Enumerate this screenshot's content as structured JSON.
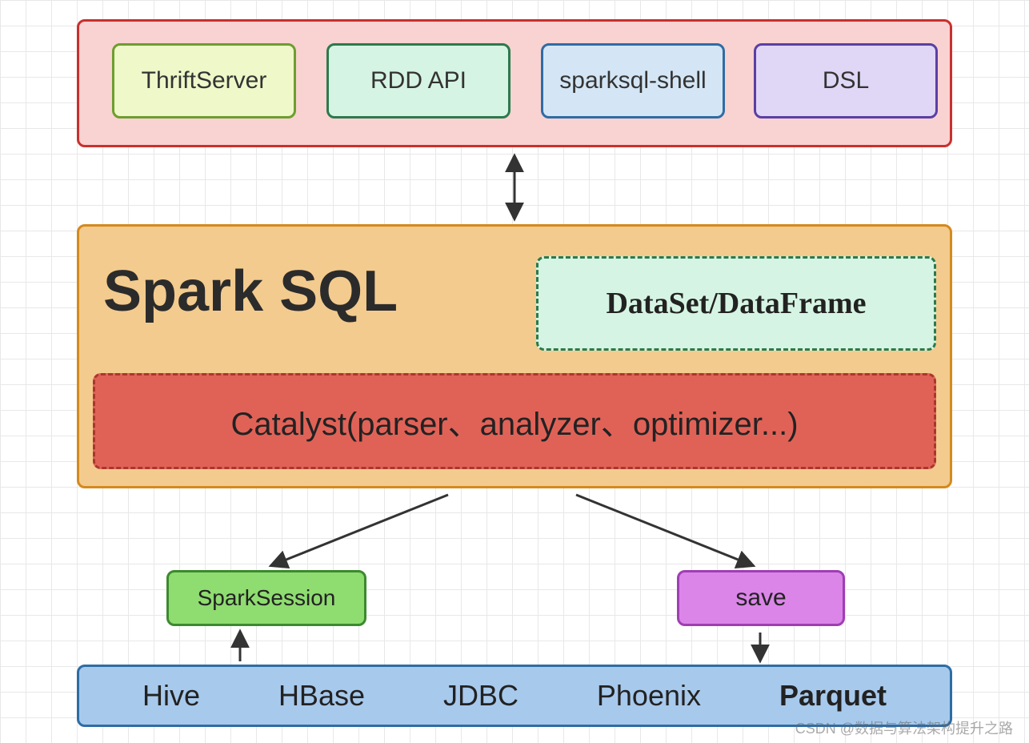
{
  "top": {
    "cells": [
      "ThriftServer",
      "RDD API",
      "sparksql-shell",
      "DSL"
    ]
  },
  "mid": {
    "title": "Spark SQL",
    "dsdf": "DataSet/DataFrame",
    "catalyst": "Catalyst(parser、analyzer、optimizer...)"
  },
  "actions": {
    "sparksession": "SparkSession",
    "save": "save"
  },
  "bottom": {
    "sources": [
      "Hive",
      "HBase",
      "JDBC",
      "Phoenix",
      "Parquet"
    ]
  },
  "watermark": "CSDN @数据与算法架构提升之路"
}
